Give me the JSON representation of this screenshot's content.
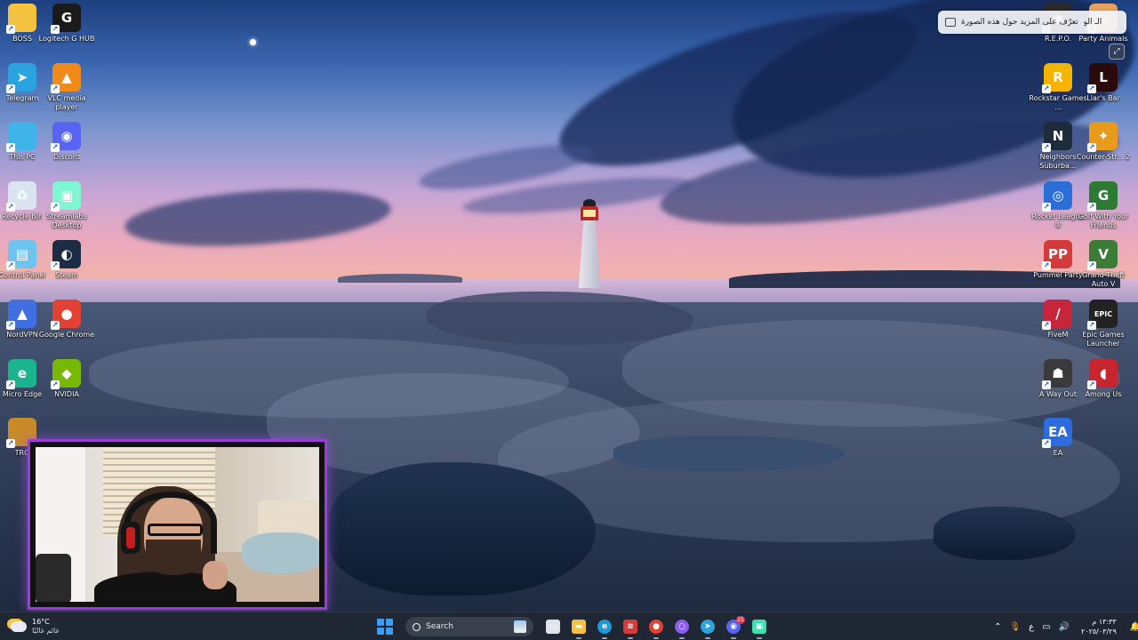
{
  "desktop": {
    "left_icons": [
      {
        "label": "BOSS",
        "icon": "folder-icon",
        "color": "#f3c33f",
        "glyph": ""
      },
      {
        "label": "Logitech G HUB",
        "icon": "logitech-g-icon",
        "color": "#1a1a1a",
        "glyph": "G"
      },
      {
        "label": "Telegram",
        "icon": "telegram-icon",
        "color": "#2aa3df",
        "glyph": "➤"
      },
      {
        "label": "VLC media player",
        "icon": "vlc-icon",
        "color": "#f08a1a",
        "glyph": "▲"
      },
      {
        "label": "This PC",
        "icon": "monitor-icon",
        "color": "#3fb4e8",
        "glyph": ""
      },
      {
        "label": "Discord",
        "icon": "discord-icon",
        "color": "#5865f2",
        "glyph": "◉"
      },
      {
        "label": "Recycle Bin",
        "icon": "recycle-bin-icon",
        "color": "#d9e4f0",
        "glyph": "♻"
      },
      {
        "label": "Streamlabs Desktop",
        "icon": "streamlabs-icon",
        "color": "#80f5d2",
        "glyph": "▣"
      },
      {
        "label": "Control Panel",
        "icon": "control-panel-icon",
        "color": "#6cc4ef",
        "glyph": "▤"
      },
      {
        "label": "Steam",
        "icon": "steam-icon",
        "color": "#1b2c44",
        "glyph": "◐"
      },
      {
        "label": "NordVPN",
        "icon": "nordvpn-icon",
        "color": "#3f6fe0",
        "glyph": "▲"
      },
      {
        "label": "Google Chrome",
        "icon": "chrome-icon",
        "color": "#e34133",
        "glyph": "●"
      },
      {
        "label": "Micro Edge",
        "icon": "edge-icon",
        "color": "#1bb48e",
        "glyph": "e"
      },
      {
        "label": "NVIDIA",
        "icon": "nvidia-icon",
        "color": "#76b900",
        "glyph": "◆"
      },
      {
        "label": "TRO",
        "icon": "tro-icon",
        "color": "#c98a2a",
        "glyph": ""
      }
    ],
    "right_icons": [
      {
        "label": "R.E.P.O.",
        "icon": "repo-icon",
        "color": "#2b2b2b",
        "glyph": "◉"
      },
      {
        "label": "Party Animals",
        "icon": "party-animals-icon",
        "color": "#e9a25b",
        "glyph": "✿"
      },
      {
        "label": "Rockstar Games ...",
        "icon": "rockstar-icon",
        "color": "#f5b400",
        "glyph": "R"
      },
      {
        "label": "Liar's Bar",
        "icon": "liars-bar-icon",
        "color": "#2a0a0a",
        "glyph": "L"
      },
      {
        "label": "Neighbors Suburba...",
        "icon": "neighbors-icon",
        "color": "#1e2b3a",
        "glyph": "N"
      },
      {
        "label": "Counter-Str... 2",
        "icon": "counter-strike-icon",
        "color": "#e89a1a",
        "glyph": "✦"
      },
      {
        "label": "Rocket League ®",
        "icon": "rocket-league-icon",
        "color": "#2a6fd8",
        "glyph": "◎"
      },
      {
        "label": "Golf With Your Friends",
        "icon": "golf-icon",
        "color": "#2d7a35",
        "glyph": "G"
      },
      {
        "label": "Pummel Party",
        "icon": "pummel-party-icon",
        "color": "#d43a3a",
        "glyph": "PP"
      },
      {
        "label": "Grand Theft Auto V",
        "icon": "gta-icon",
        "color": "#3b7d36",
        "glyph": "V"
      },
      {
        "label": "FiveM",
        "icon": "fivem-icon",
        "color": "#c7253a",
        "glyph": "/"
      },
      {
        "label": "Epic Games Launcher",
        "icon": "epic-games-icon",
        "color": "#222222",
        "glyph": "EPIC"
      },
      {
        "label": "A Way Out",
        "icon": "a-way-out-icon",
        "color": "#3a3a3a",
        "glyph": "☗"
      },
      {
        "label": "Among Us",
        "icon": "among-us-icon",
        "color": "#c8252e",
        "glyph": "◖"
      },
      {
        "label": "EA",
        "icon": "ea-icon",
        "color": "#2d6be0",
        "glyph": "EA"
      }
    ]
  },
  "visual_search": {
    "text": "تعرّف على المزيد حول هذه الصورة",
    "prefix": "الـ الو"
  },
  "taskbar": {
    "weather": {
      "temp": "16°C",
      "condition": "غائم غالبًا",
      "icon": "partly-cloudy-icon"
    },
    "search_placeholder": "Search",
    "apps": [
      {
        "icon": "task-view-icon",
        "color": "#dfe4ec",
        "glyph": "▭"
      },
      {
        "icon": "file-explorer-icon",
        "color": "#f3c33f",
        "glyph": "▬"
      },
      {
        "icon": "edge-icon",
        "color": "#1f9ad8",
        "glyph": "e"
      },
      {
        "icon": "red-app-icon",
        "color": "#d83a3a",
        "glyph": "≋"
      },
      {
        "icon": "chrome-icon",
        "color": "#e34133",
        "glyph": "●"
      },
      {
        "icon": "opera-gx-icon",
        "color": "#8a5cf0",
        "glyph": "○"
      },
      {
        "icon": "telegram-icon",
        "color": "#2aa3df",
        "glyph": "➤"
      },
      {
        "icon": "discord-icon",
        "color": "#5865f2",
        "glyph": "◉",
        "badge": "25"
      },
      {
        "icon": "streamlabs-icon",
        "color": "#3ee0b2",
        "glyph": "▣"
      }
    ],
    "tray": {
      "lang": "ع",
      "time": "١٣:٣٣ م",
      "date": "٢٠٢٥/٠٣/٢٩"
    }
  }
}
